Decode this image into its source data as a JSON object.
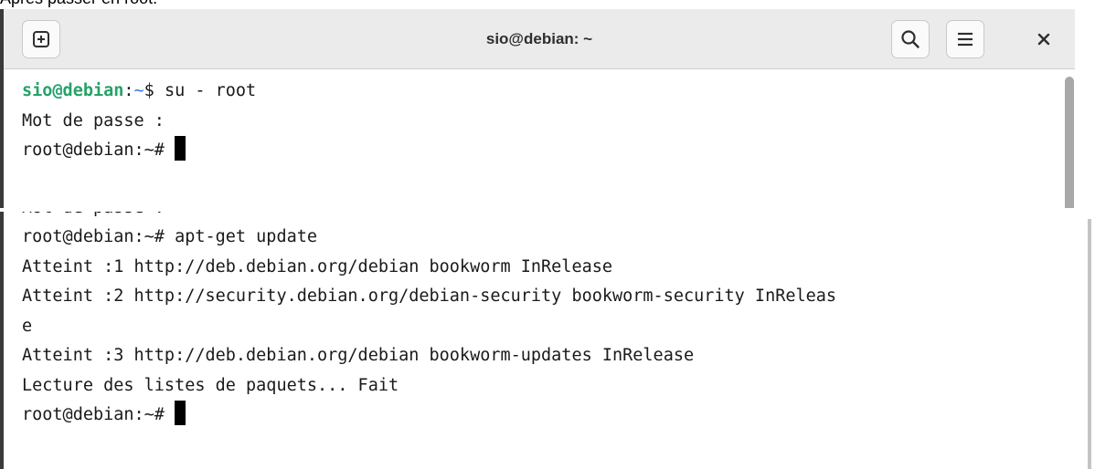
{
  "caption": "Après passer en root.",
  "terminal_top": {
    "window_title": "sio@debian: ~",
    "new_tab_icon": "new-tab-icon",
    "search_icon": "search-icon",
    "menu_icon": "hamburger-menu-icon",
    "close_icon": "close-icon",
    "lines": {
      "l1_user": "sio@debian",
      "l1_sep": ":",
      "l1_path": "~",
      "l1_cmd": "$ su - root",
      "l2": "Mot de passe :",
      "l3": "root@debian:~# "
    }
  },
  "terminal_bottom": {
    "lines": [
      "Mot de passe :",
      "root@debian:~# apt-get update",
      "Atteint :1 http://deb.debian.org/debian bookworm InRelease",
      "Atteint :2 http://security.debian.org/debian-security bookworm-security InReleas",
      "e",
      "Atteint :3 http://deb.debian.org/debian bookworm-updates InRelease",
      "Lecture des listes de paquets... Fait",
      "root@debian:~# "
    ]
  },
  "colors": {
    "prompt_user": "#26a269",
    "prompt_path": "#2a7bde",
    "titlebar": "#ebebeb"
  }
}
